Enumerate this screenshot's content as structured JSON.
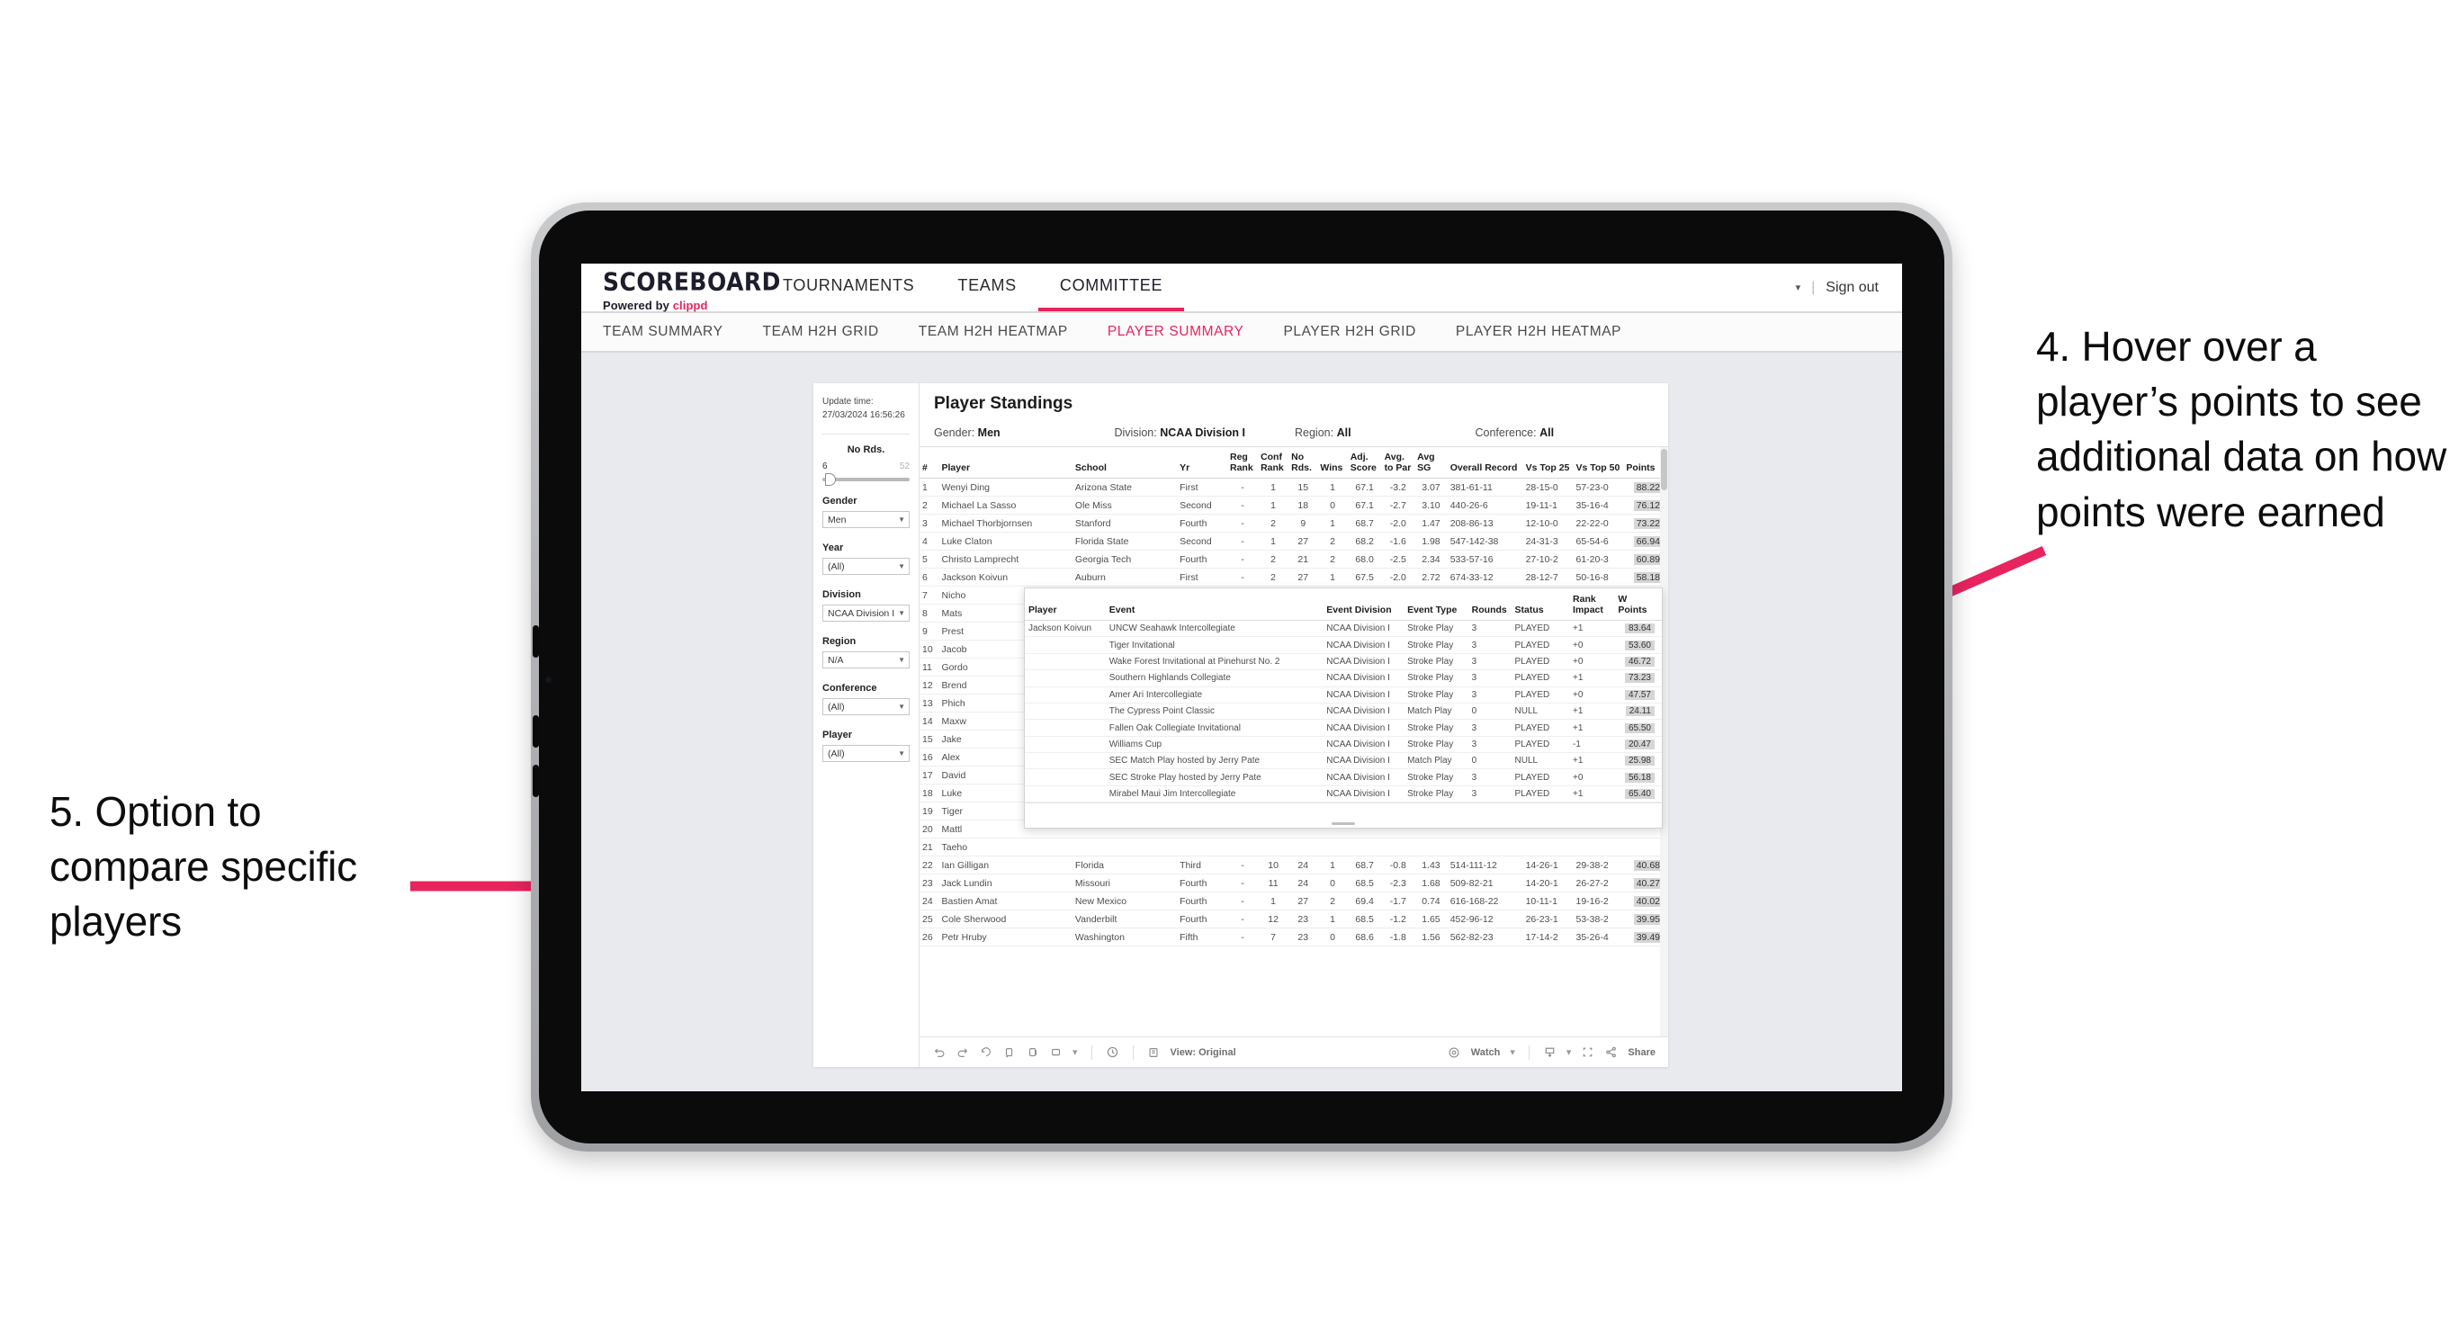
{
  "annotations": {
    "right": "4. Hover over a player’s points to see additional data on how points were earned",
    "left": "5. Option to compare specific players",
    "arrow_color": "#e8245e"
  },
  "app": {
    "brand": {
      "name": "SCOREBOARD",
      "powered_prefix": "Powered by ",
      "powered_brand": "clippd"
    },
    "topnav": [
      {
        "label": "TOURNAMENTS",
        "active": false
      },
      {
        "label": "TEAMS",
        "active": false
      },
      {
        "label": "COMMITTEE",
        "active": true
      }
    ],
    "topbar_right": {
      "user_caret": "▾",
      "separator": "|",
      "sign_out": "Sign out"
    },
    "subnav": [
      {
        "label": "TEAM SUMMARY",
        "active": false
      },
      {
        "label": "TEAM H2H GRID",
        "active": false
      },
      {
        "label": "TEAM H2H HEATMAP",
        "active": false
      },
      {
        "label": "PLAYER SUMMARY",
        "active": true
      },
      {
        "label": "PLAYER H2H GRID",
        "active": false
      },
      {
        "label": "PLAYER H2H HEATMAP",
        "active": false
      }
    ]
  },
  "viz": {
    "update_time_label": "Update time:",
    "update_time_value": "27/03/2024 16:56:26",
    "title": "Player Standings",
    "summary_filters": [
      {
        "label": "Gender:",
        "value": "Men"
      },
      {
        "label": "Division:",
        "value": "NCAA Division I"
      },
      {
        "label": "Region:",
        "value": "All"
      },
      {
        "label": "Conference:",
        "value": "All"
      }
    ],
    "slider": {
      "title": "No Rds.",
      "min": "6",
      "max": "52"
    },
    "filters": [
      {
        "label": "Gender",
        "value": "Men"
      },
      {
        "label": "Year",
        "value": "(All)"
      },
      {
        "label": "Division",
        "value": "NCAA Division I"
      },
      {
        "label": "Region",
        "value": "N/A"
      },
      {
        "label": "Conference",
        "value": "(All)"
      },
      {
        "label": "Player",
        "value": "(All)"
      }
    ],
    "table": {
      "columns": [
        "#",
        "Player",
        "School",
        "Yr",
        "Reg Rank",
        "Conf Rank",
        "No Rds.",
        "Wins",
        "Adj. Score",
        "Avg. to Par",
        "Avg SG",
        "Overall Record",
        "Vs Top 25",
        "Vs Top 50",
        "Points"
      ],
      "rows": [
        {
          "n": "1",
          "player": "Wenyi Ding",
          "school": "Arizona State",
          "yr": "First",
          "reg": "-",
          "conf": "1",
          "rds": "15",
          "wins": "1",
          "adj": "67.1",
          "par": "-3.2",
          "sg": "3.07",
          "rec": "381-61-11",
          "t25": "28-15-0",
          "t50": "57-23-0",
          "pts": "88.22"
        },
        {
          "n": "2",
          "player": "Michael La Sasso",
          "school": "Ole Miss",
          "yr": "Second",
          "reg": "-",
          "conf": "1",
          "rds": "18",
          "wins": "0",
          "adj": "67.1",
          "par": "-2.7",
          "sg": "3.10",
          "rec": "440-26-6",
          "t25": "19-11-1",
          "t50": "35-16-4",
          "pts": "76.12"
        },
        {
          "n": "3",
          "player": "Michael Thorbjornsen",
          "school": "Stanford",
          "yr": "Fourth",
          "reg": "-",
          "conf": "2",
          "rds": "9",
          "wins": "1",
          "adj": "68.7",
          "par": "-2.0",
          "sg": "1.47",
          "rec": "208-86-13",
          "t25": "12-10-0",
          "t50": "22-22-0",
          "pts": "73.22"
        },
        {
          "n": "4",
          "player": "Luke Claton",
          "school": "Florida State",
          "yr": "Second",
          "reg": "-",
          "conf": "1",
          "rds": "27",
          "wins": "2",
          "adj": "68.2",
          "par": "-1.6",
          "sg": "1.98",
          "rec": "547-142-38",
          "t25": "24-31-3",
          "t50": "65-54-6",
          "pts": "66.94"
        },
        {
          "n": "5",
          "player": "Christo Lamprecht",
          "school": "Georgia Tech",
          "yr": "Fourth",
          "reg": "-",
          "conf": "2",
          "rds": "21",
          "wins": "2",
          "adj": "68.0",
          "par": "-2.5",
          "sg": "2.34",
          "rec": "533-57-16",
          "t25": "27-10-2",
          "t50": "61-20-3",
          "pts": "60.89"
        },
        {
          "n": "6",
          "player": "Jackson Koivun",
          "school": "Auburn",
          "yr": "First",
          "reg": "-",
          "conf": "2",
          "rds": "27",
          "wins": "1",
          "adj": "67.5",
          "par": "-2.0",
          "sg": "2.72",
          "rec": "674-33-12",
          "t25": "28-12-7",
          "t50": "50-16-8",
          "pts": "58.18"
        },
        {
          "n": "7",
          "player": "Nicho",
          "school": "",
          "yr": "",
          "reg": "",
          "conf": "",
          "rds": "",
          "wins": "",
          "adj": "",
          "par": "",
          "sg": "",
          "rec": "",
          "t25": "",
          "t50": "",
          "pts": ""
        },
        {
          "n": "8",
          "player": "Mats",
          "school": "",
          "yr": "",
          "reg": "",
          "conf": "",
          "rds": "",
          "wins": "",
          "adj": "",
          "par": "",
          "sg": "",
          "rec": "",
          "t25": "",
          "t50": "",
          "pts": ""
        },
        {
          "n": "9",
          "player": "Prest",
          "school": "",
          "yr": "",
          "reg": "",
          "conf": "",
          "rds": "",
          "wins": "",
          "adj": "",
          "par": "",
          "sg": "",
          "rec": "",
          "t25": "",
          "t50": "",
          "pts": ""
        },
        {
          "n": "10",
          "player": "Jacob",
          "school": "",
          "yr": "",
          "reg": "",
          "conf": "",
          "rds": "",
          "wins": "",
          "adj": "",
          "par": "",
          "sg": "",
          "rec": "",
          "t25": "",
          "t50": "",
          "pts": ""
        },
        {
          "n": "11",
          "player": "Gordo",
          "school": "",
          "yr": "",
          "reg": "",
          "conf": "",
          "rds": "",
          "wins": "",
          "adj": "",
          "par": "",
          "sg": "",
          "rec": "",
          "t25": "",
          "t50": "",
          "pts": ""
        },
        {
          "n": "12",
          "player": "Brend",
          "school": "",
          "yr": "",
          "reg": "",
          "conf": "",
          "rds": "",
          "wins": "",
          "adj": "",
          "par": "",
          "sg": "",
          "rec": "",
          "t25": "",
          "t50": "",
          "pts": ""
        },
        {
          "n": "13",
          "player": "Phich",
          "school": "",
          "yr": "",
          "reg": "",
          "conf": "",
          "rds": "",
          "wins": "",
          "adj": "",
          "par": "",
          "sg": "",
          "rec": "",
          "t25": "",
          "t50": "",
          "pts": ""
        },
        {
          "n": "14",
          "player": "Maxw",
          "school": "",
          "yr": "",
          "reg": "",
          "conf": "",
          "rds": "",
          "wins": "",
          "adj": "",
          "par": "",
          "sg": "",
          "rec": "",
          "t25": "",
          "t50": "",
          "pts": ""
        },
        {
          "n": "15",
          "player": "Jake",
          "school": "",
          "yr": "",
          "reg": "",
          "conf": "",
          "rds": "",
          "wins": "",
          "adj": "",
          "par": "",
          "sg": "",
          "rec": "",
          "t25": "",
          "t50": "",
          "pts": ""
        },
        {
          "n": "16",
          "player": "Alex",
          "school": "",
          "yr": "",
          "reg": "",
          "conf": "",
          "rds": "",
          "wins": "",
          "adj": "",
          "par": "",
          "sg": "",
          "rec": "",
          "t25": "",
          "t50": "",
          "pts": ""
        },
        {
          "n": "17",
          "player": "David",
          "school": "",
          "yr": "",
          "reg": "",
          "conf": "",
          "rds": "",
          "wins": "",
          "adj": "",
          "par": "",
          "sg": "",
          "rec": "",
          "t25": "",
          "t50": "",
          "pts": ""
        },
        {
          "n": "18",
          "player": "Luke",
          "school": "",
          "yr": "",
          "reg": "",
          "conf": "",
          "rds": "",
          "wins": "",
          "adj": "",
          "par": "",
          "sg": "",
          "rec": "",
          "t25": "",
          "t50": "",
          "pts": ""
        },
        {
          "n": "19",
          "player": "Tiger",
          "school": "",
          "yr": "",
          "reg": "",
          "conf": "",
          "rds": "",
          "wins": "",
          "adj": "",
          "par": "",
          "sg": "",
          "rec": "",
          "t25": "",
          "t50": "",
          "pts": ""
        },
        {
          "n": "20",
          "player": "Mattl",
          "school": "",
          "yr": "",
          "reg": "",
          "conf": "",
          "rds": "",
          "wins": "",
          "adj": "",
          "par": "",
          "sg": "",
          "rec": "",
          "t25": "",
          "t50": "",
          "pts": ""
        },
        {
          "n": "21",
          "player": "Taeho",
          "school": "",
          "yr": "",
          "reg": "",
          "conf": "",
          "rds": "",
          "wins": "",
          "adj": "",
          "par": "",
          "sg": "",
          "rec": "",
          "t25": "",
          "t50": "",
          "pts": ""
        },
        {
          "n": "22",
          "player": "Ian Gilligan",
          "school": "Florida",
          "yr": "Third",
          "reg": "-",
          "conf": "10",
          "rds": "24",
          "wins": "1",
          "adj": "68.7",
          "par": "-0.8",
          "sg": "1.43",
          "rec": "514-111-12",
          "t25": "14-26-1",
          "t50": "29-38-2",
          "pts": "40.68"
        },
        {
          "n": "23",
          "player": "Jack Lundin",
          "school": "Missouri",
          "yr": "Fourth",
          "reg": "-",
          "conf": "11",
          "rds": "24",
          "wins": "0",
          "adj": "68.5",
          "par": "-2.3",
          "sg": "1.68",
          "rec": "509-82-21",
          "t25": "14-20-1",
          "t50": "26-27-2",
          "pts": "40.27"
        },
        {
          "n": "24",
          "player": "Bastien Amat",
          "school": "New Mexico",
          "yr": "Fourth",
          "reg": "-",
          "conf": "1",
          "rds": "27",
          "wins": "2",
          "adj": "69.4",
          "par": "-1.7",
          "sg": "0.74",
          "rec": "616-168-22",
          "t25": "10-11-1",
          "t50": "19-16-2",
          "pts": "40.02"
        },
        {
          "n": "25",
          "player": "Cole Sherwood",
          "school": "Vanderbilt",
          "yr": "Fourth",
          "reg": "-",
          "conf": "12",
          "rds": "23",
          "wins": "1",
          "adj": "68.5",
          "par": "-1.2",
          "sg": "1.65",
          "rec": "452-96-12",
          "t25": "26-23-1",
          "t50": "53-38-2",
          "pts": "39.95"
        },
        {
          "n": "26",
          "player": "Petr Hruby",
          "school": "Washington",
          "yr": "Fifth",
          "reg": "-",
          "conf": "7",
          "rds": "23",
          "wins": "0",
          "adj": "68.6",
          "par": "-1.8",
          "sg": "1.56",
          "rec": "562-82-23",
          "t25": "17-14-2",
          "t50": "35-26-4",
          "pts": "39.49"
        }
      ]
    },
    "tooltip": {
      "columns": [
        "Player",
        "Event",
        "Event Division",
        "Event Type",
        "Rounds",
        "Status",
        "Rank Impact",
        "W Points"
      ],
      "player": "Jackson Koivun",
      "rows": [
        {
          "event": "UNCW Seahawk Intercollegiate",
          "division": "NCAA Division I",
          "type": "Stroke Play",
          "rounds": "3",
          "status": "PLAYED",
          "impact": "+1",
          "points": "83.64"
        },
        {
          "event": "Tiger Invitational",
          "division": "NCAA Division I",
          "type": "Stroke Play",
          "rounds": "3",
          "status": "PLAYED",
          "impact": "+0",
          "points": "53.60"
        },
        {
          "event": "Wake Forest Invitational at Pinehurst No. 2",
          "division": "NCAA Division I",
          "type": "Stroke Play",
          "rounds": "3",
          "status": "PLAYED",
          "impact": "+0",
          "points": "46.72"
        },
        {
          "event": "Southern Highlands Collegiate",
          "division": "NCAA Division I",
          "type": "Stroke Play",
          "rounds": "3",
          "status": "PLAYED",
          "impact": "+1",
          "points": "73.23"
        },
        {
          "event": "Amer Ari Intercollegiate",
          "division": "NCAA Division I",
          "type": "Stroke Play",
          "rounds": "3",
          "status": "PLAYED",
          "impact": "+0",
          "points": "47.57"
        },
        {
          "event": "The Cypress Point Classic",
          "division": "NCAA Division I",
          "type": "Match Play",
          "rounds": "0",
          "status": "NULL",
          "impact": "+1",
          "points": "24.11"
        },
        {
          "event": "Fallen Oak Collegiate Invitational",
          "division": "NCAA Division I",
          "type": "Stroke Play",
          "rounds": "3",
          "status": "PLAYED",
          "impact": "+1",
          "points": "65.50"
        },
        {
          "event": "Williams Cup",
          "division": "NCAA Division I",
          "type": "Stroke Play",
          "rounds": "3",
          "status": "PLAYED",
          "impact": "-1",
          "points": "20.47"
        },
        {
          "event": "SEC Match Play hosted by Jerry Pate",
          "division": "NCAA Division I",
          "type": "Match Play",
          "rounds": "0",
          "status": "NULL",
          "impact": "+1",
          "points": "25.98"
        },
        {
          "event": "SEC Stroke Play hosted by Jerry Pate",
          "division": "NCAA Division I",
          "type": "Stroke Play",
          "rounds": "3",
          "status": "PLAYED",
          "impact": "+0",
          "points": "56.18"
        },
        {
          "event": "Mirabel Maui Jim Intercollegiate",
          "division": "NCAA Division I",
          "type": "Stroke Play",
          "rounds": "3",
          "status": "PLAYED",
          "impact": "+1",
          "points": "65.40"
        }
      ]
    },
    "toolbar": {
      "view_label": "View: Original",
      "watch_label": "Watch",
      "share_label": "Share",
      "caret": "▾"
    }
  }
}
